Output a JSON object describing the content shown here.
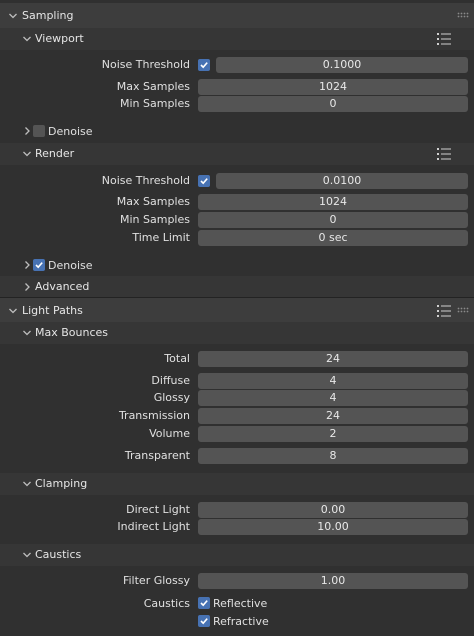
{
  "sampling": {
    "title": "Sampling",
    "viewport": {
      "title": "Viewport",
      "noise_threshold_label": "Noise Threshold",
      "noise_threshold_enabled": true,
      "noise_threshold_value": "0.1000",
      "max_samples_label": "Max Samples",
      "max_samples_value": "1024",
      "min_samples_label": "Min Samples",
      "min_samples_value": "0",
      "denoise_label": "Denoise",
      "denoise_enabled": false
    },
    "render": {
      "title": "Render",
      "noise_threshold_label": "Noise Threshold",
      "noise_threshold_enabled": true,
      "noise_threshold_value": "0.0100",
      "max_samples_label": "Max Samples",
      "max_samples_value": "1024",
      "min_samples_label": "Min Samples",
      "min_samples_value": "0",
      "time_limit_label": "Time Limit",
      "time_limit_value": "0 sec",
      "denoise_label": "Denoise",
      "denoise_enabled": true
    },
    "advanced": {
      "title": "Advanced"
    }
  },
  "light_paths": {
    "title": "Light Paths",
    "max_bounces": {
      "title": "Max Bounces",
      "total_label": "Total",
      "total_value": "24",
      "diffuse_label": "Diffuse",
      "diffuse_value": "4",
      "glossy_label": "Glossy",
      "glossy_value": "4",
      "transmission_label": "Transmission",
      "transmission_value": "24",
      "volume_label": "Volume",
      "volume_value": "2",
      "transparent_label": "Transparent",
      "transparent_value": "8"
    },
    "clamping": {
      "title": "Clamping",
      "direct_light_label": "Direct Light",
      "direct_light_value": "0.00",
      "indirect_light_label": "Indirect Light",
      "indirect_light_value": "10.00"
    },
    "caustics": {
      "title": "Caustics",
      "filter_glossy_label": "Filter Glossy",
      "filter_glossy_value": "1.00",
      "caustics_label": "Caustics",
      "reflective_label": "Reflective",
      "reflective_enabled": true,
      "refractive_label": "Refractive",
      "refractive_enabled": true
    }
  },
  "colors": {
    "background": "#303030",
    "panel_header": "#3d3d3d",
    "field": "#545454",
    "checkbox_on": "#4772b3"
  }
}
